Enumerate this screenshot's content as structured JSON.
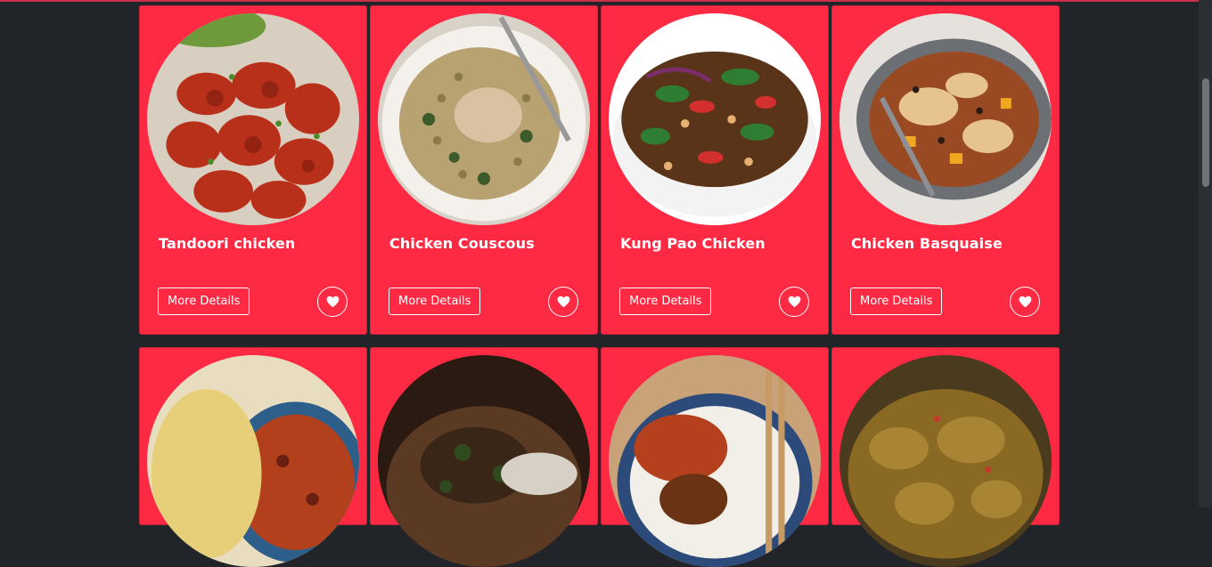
{
  "recipes": [
    {
      "title": "Tandoori chicken",
      "button": "More Details",
      "fav_icon": "heart-icon"
    },
    {
      "title": "Chicken Couscous",
      "button": "More Details",
      "fav_icon": "heart-icon"
    },
    {
      "title": "Kung Pao Chicken",
      "button": "More Details",
      "fav_icon": "heart-icon"
    },
    {
      "title": "Chicken Basquaise",
      "button": "More Details",
      "fav_icon": "heart-icon"
    }
  ],
  "colors": {
    "page_background": "#212529",
    "card_background": "#fe2a44",
    "text": "#ffffff"
  }
}
